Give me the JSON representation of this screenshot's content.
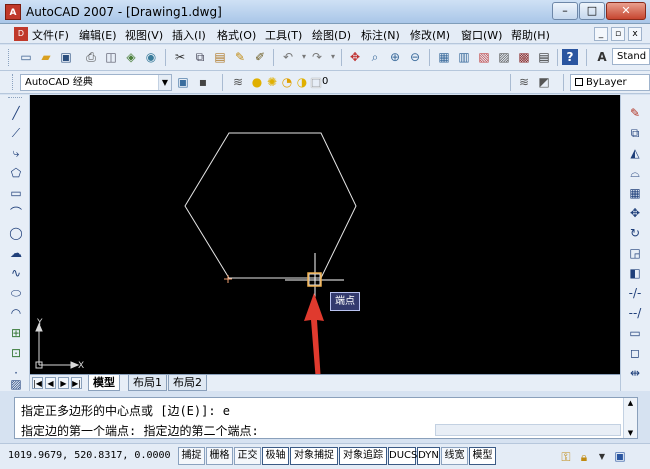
{
  "window": {
    "title": "AutoCAD 2007 - [Drawing1.dwg]",
    "app_icon_label": "A",
    "controls": [
      "–",
      "□",
      "✕"
    ]
  },
  "menu": {
    "items": [
      "文件(F)",
      "编辑(E)",
      "视图(V)",
      "插入(I)",
      "格式(O)",
      "工具(T)",
      "绘图(D)",
      "标注(N)",
      "修改(M)",
      "窗口(W)",
      "帮助(H)"
    ],
    "mdi_controls": [
      "_",
      "▫",
      "x"
    ]
  },
  "toolbar": {
    "text_style_combo": "Stand",
    "workspace_combo": "AutoCAD 经典",
    "layer_combo": "0",
    "linetype_combo": "ByLayer"
  },
  "canvas": {
    "background": "#000000",
    "drawing_color": "#ffffff",
    "ucs_x_label": "X",
    "ucs_y_label": "Y",
    "tooltip": "端点",
    "arrow_color": "#e03a2e"
  },
  "layout_tabs": {
    "nav": [
      "|◀",
      "◀",
      "▶",
      "▶|"
    ],
    "tabs": [
      "模型",
      "布局1",
      "布局2"
    ],
    "active_index": 0
  },
  "command": {
    "lines": [
      "指定正多边形的中心点或 [边(E)]: e",
      "指定边的第一个端点: 指定边的第二个端点:"
    ]
  },
  "status": {
    "coordinates": "1019.9679, 520.8317, 0.0000",
    "toggles": [
      "捕捉",
      "栅格",
      "正交",
      "极轴",
      "对象捕捉",
      "对象追踪",
      "DUCS",
      "DYN",
      "线宽",
      "模型"
    ]
  }
}
